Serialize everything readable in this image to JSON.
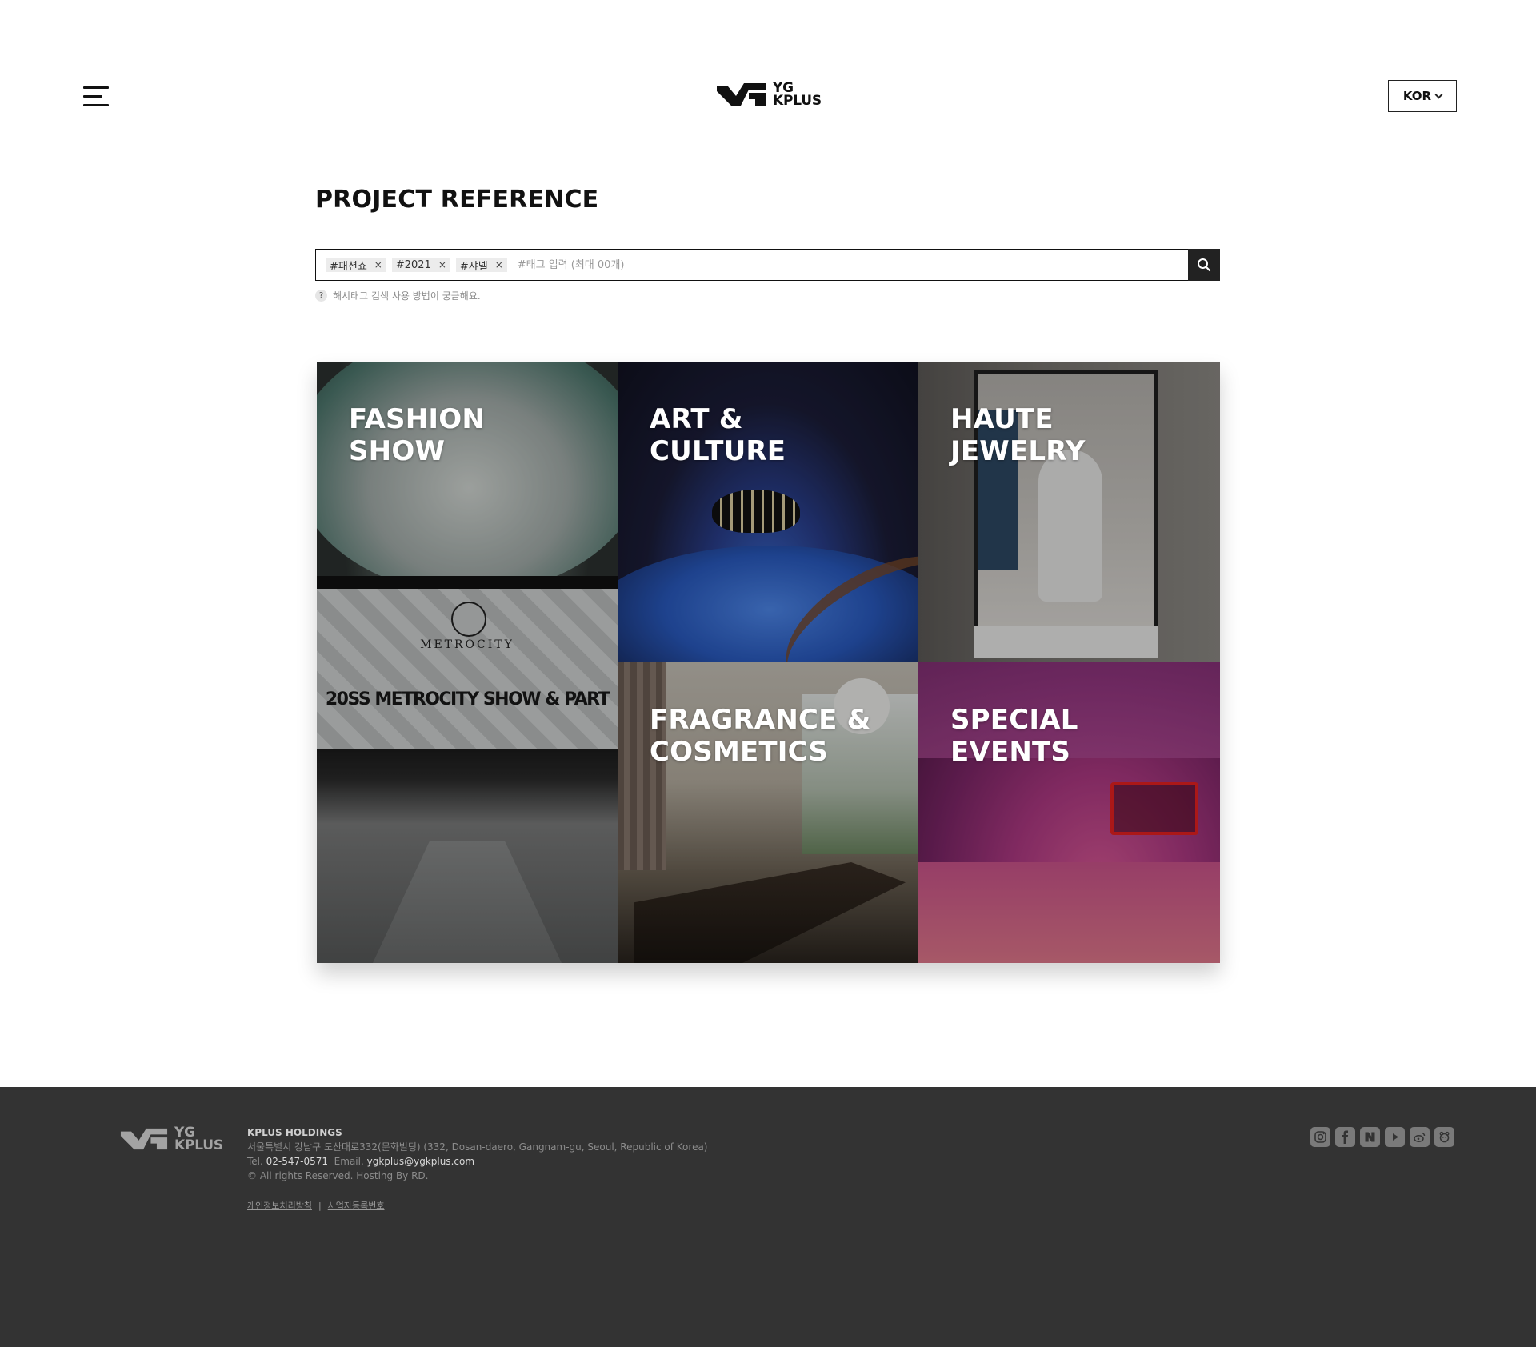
{
  "header": {
    "logo_line1": "YG",
    "logo_line2": "KPLUS",
    "language": "KOR"
  },
  "main": {
    "title": "PROJECT REFERENCE",
    "search": {
      "tags": [
        "#패션쇼",
        "#2021",
        "#샤넬"
      ],
      "tag_remove": "×",
      "placeholder": "#태그 입력 (최대 00개)",
      "help_icon": "?",
      "help_text": "해시태그 검색 사용 방법이 궁금해요."
    },
    "categories": [
      {
        "line1": "FASHION",
        "line2": "SHOW"
      },
      {
        "line1": "ART &",
        "line2": "CULTURE"
      },
      {
        "line1": "HAUTE",
        "line2": "JEWELRY"
      },
      {
        "line1": "FRAGRANCE &",
        "line2": "COSMETICS"
      },
      {
        "line1": "SPECIAL",
        "line2": "EVENTS"
      }
    ],
    "fashion_image": {
      "brand": "METROCITY",
      "banner": "20SS METROCITY SHOW & PART"
    }
  },
  "footer": {
    "logo_line1": "YG",
    "logo_line2": "KPLUS",
    "company": "KPLUS HOLDINGS",
    "address": "서울특별시 강남구 도산대로332(문화빌딩) (332, Dosan-daero, Gangnam-gu, Seoul, Republic of Korea)",
    "tel_label": "Tel.",
    "tel": "02-547-0571",
    "email_label": "Email.",
    "email": "ygkplus@ygkplus.com",
    "copyright": "© All rights Reserved. Hosting By RD.",
    "links": [
      "개인정보처리방침",
      "사업자등록번호"
    ],
    "link_separator": "|",
    "social": [
      "instagram-icon",
      "facebook-icon",
      "naver-icon",
      "youtube-icon",
      "weibo-icon",
      "kakao-icon"
    ]
  }
}
